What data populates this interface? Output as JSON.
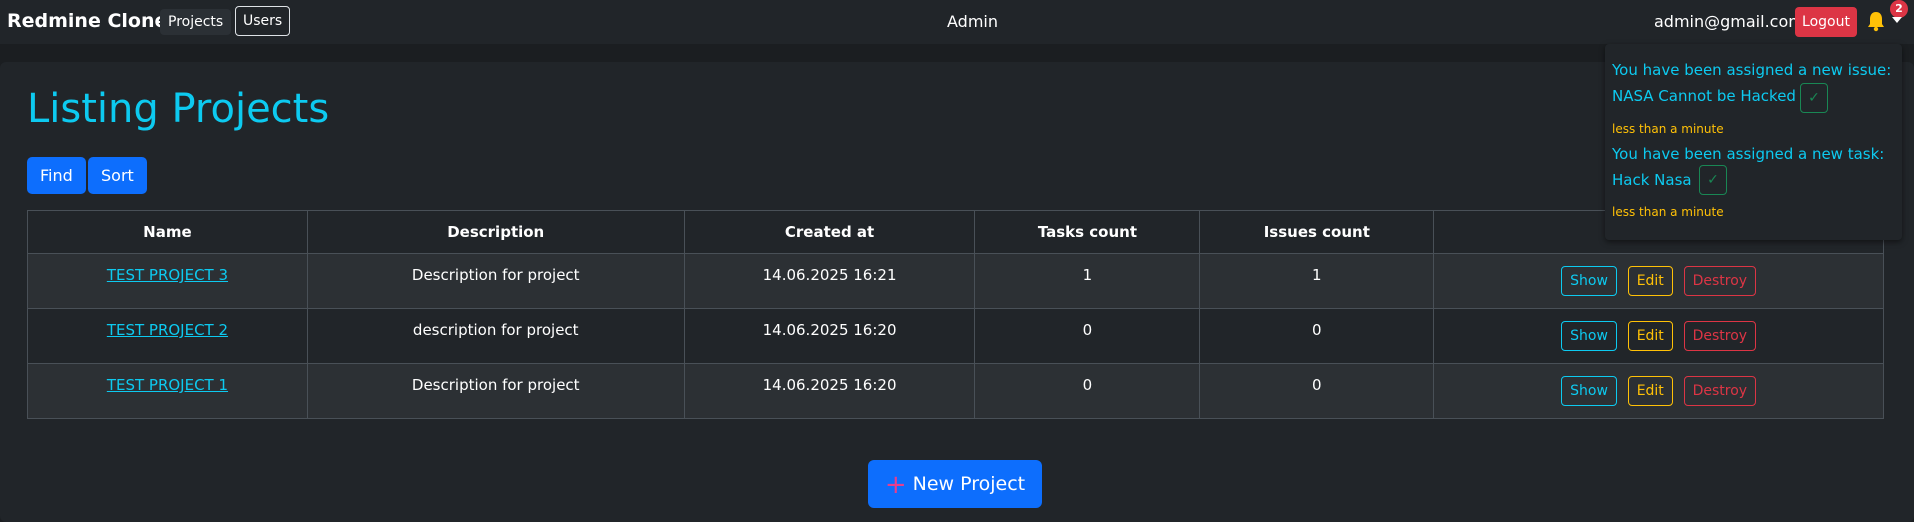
{
  "navbar": {
    "brand": "Redmine Clone",
    "projects_label": "Projects",
    "users_label": "Users",
    "center_label": "Admin",
    "email": "admin@gmail.com",
    "logout_label": "Logout",
    "notification_count": "2"
  },
  "main": {
    "title": "Listing Projects",
    "find_label": "Find",
    "sort_label": "Sort",
    "new_project_label": "New Project"
  },
  "table": {
    "headers": [
      "Name",
      "Description",
      "Created at",
      "Tasks count",
      "Issues count",
      ""
    ],
    "rows": [
      {
        "name": "TEST PROJECT 3",
        "description": "Description for project",
        "created_at": "14.06.2025 16:21",
        "tasks": "1",
        "issues": "1"
      },
      {
        "name": "TEST PROJECT 2",
        "description": "description for project",
        "created_at": "14.06.2025 16:20",
        "tasks": "0",
        "issues": "0"
      },
      {
        "name": "TEST PROJECT 1",
        "description": "Description for project",
        "created_at": "14.06.2025 16:20",
        "tasks": "0",
        "issues": "0"
      }
    ],
    "show_label": "Show",
    "edit_label": "Edit",
    "destroy_label": "Destroy"
  },
  "notifications": [
    {
      "line1": "You have been assigned a new issue:",
      "line2": "NASA Cannot be Hacked",
      "check": "✓",
      "time": "less than a minute"
    },
    {
      "line1": "You have been assigned a new task:",
      "line2": "Hack Nasa",
      "check": "✓",
      "time": "less than a minute"
    }
  ],
  "colors": {
    "accent": "#0dcaf0",
    "primary": "#0d6efd",
    "danger": "#dc3545",
    "warning": "#ffc107",
    "success": "#198754",
    "background": "#1b1e21"
  },
  "icons": {
    "bell": "bell-icon",
    "caret": "caret-down-icon",
    "plus": "plus-icon",
    "check": "check-icon"
  }
}
